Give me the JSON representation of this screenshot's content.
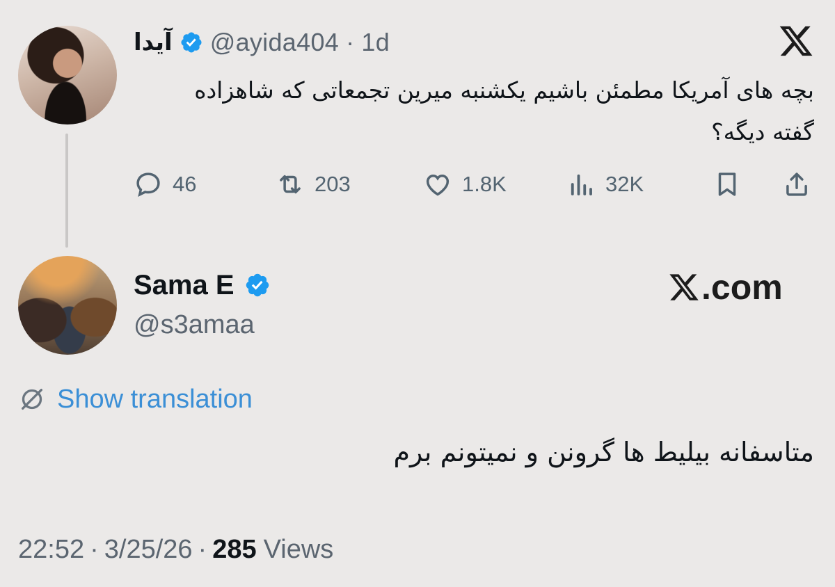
{
  "tweet1": {
    "display_name": "آیدا",
    "handle": "@ayida404",
    "separator": "·",
    "age": "1d",
    "text": "بچه های آمریکا مطمئن باشیم یکشنبه میرین تجمعاتی که شاهزاده گفته دیگه؟",
    "actions": {
      "replies": "46",
      "reposts": "203",
      "likes": "1.8K",
      "views": "32K"
    }
  },
  "tweet2": {
    "display_name": "Sama E",
    "handle": "@s3amaa",
    "watermark": ".com",
    "show_translation": "Show translation",
    "text": "متاسفانه بیلیط ها گرونن و نمیتونم برم",
    "time": "22:52",
    "date": "3/25/26",
    "separator": "·",
    "views_count": "285",
    "views_label": "Views"
  },
  "colors": {
    "background": "#ebe9e8",
    "verified_badge": "#1d9bf0",
    "link": "#3b8fd6",
    "secondary_text": "#5b6570"
  },
  "icons": [
    "verified-badge-icon",
    "x-logo-icon",
    "reply-icon",
    "repost-icon",
    "like-icon",
    "views-icon",
    "bookmark-icon",
    "share-icon",
    "translate-globe-icon"
  ]
}
